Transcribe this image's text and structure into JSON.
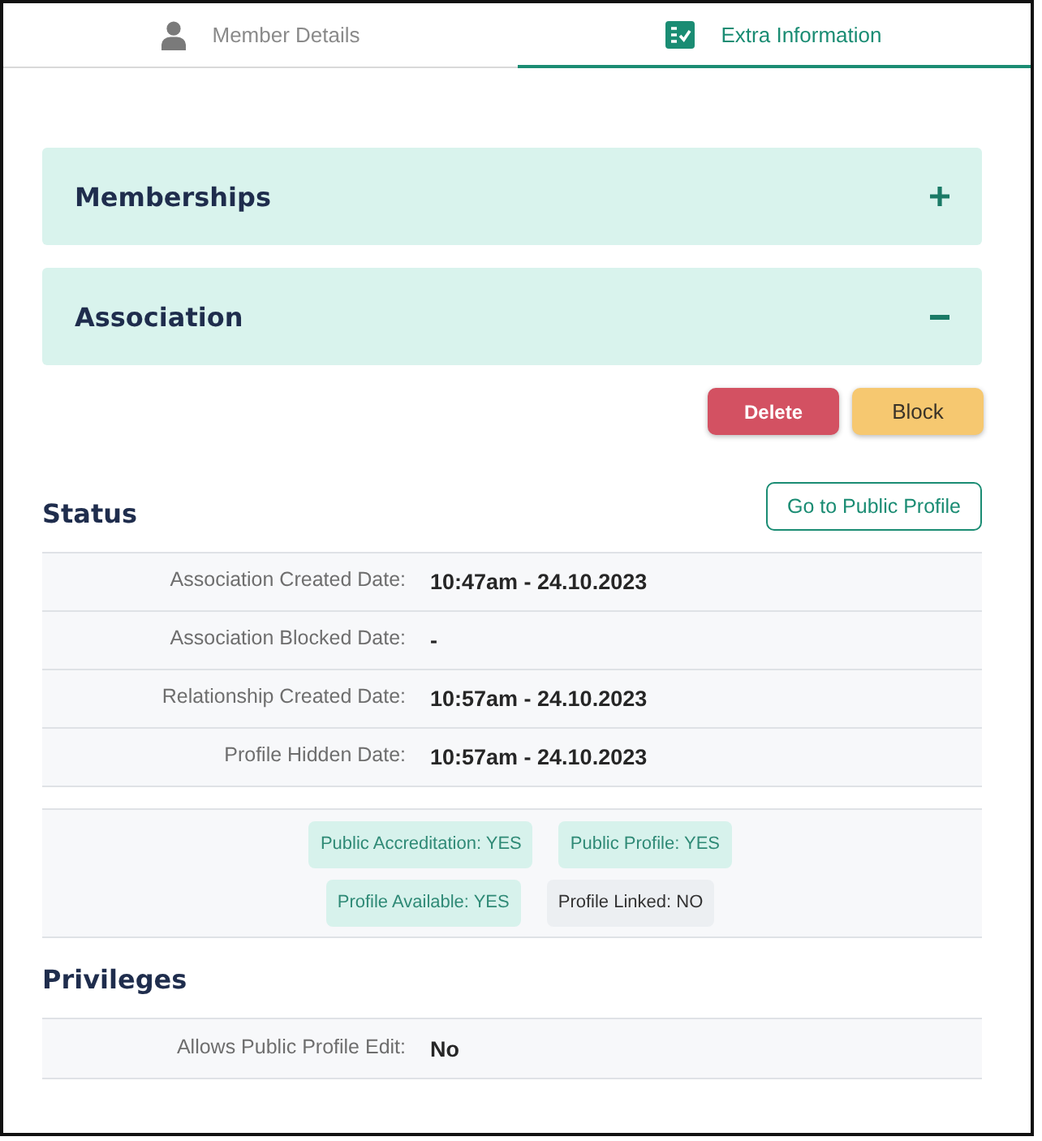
{
  "tabs": [
    {
      "label": "Member Details",
      "kind": "person",
      "selected": false
    },
    {
      "label": "Extra Information",
      "kind": "checklist",
      "selected": true
    }
  ],
  "accordions": [
    {
      "title": "Memberships",
      "expanded": false
    },
    {
      "title": "Association",
      "expanded": true
    }
  ],
  "actions": [
    {
      "label": "Delete",
      "kind": "danger"
    },
    {
      "label": "Block",
      "kind": "warning"
    }
  ],
  "status": {
    "heading": "Status",
    "link_button": "Go to Public Profile",
    "rows": [
      {
        "label": "Association Created Date:",
        "value": "10:47am - 24.10.2023"
      },
      {
        "label": "Association Blocked Date:",
        "value": "-"
      },
      {
        "label": "Relationship Created Date:",
        "value": "10:57am - 24.10.2023"
      },
      {
        "label": "Profile Hidden Date:",
        "value": "10:57am - 24.10.2023"
      }
    ],
    "badge_rows": [
      {
        "badges": [
          {
            "text": "Public Accreditation: YES",
            "active": true
          },
          {
            "text": "Public Profile: YES",
            "active": true
          }
        ]
      },
      {
        "badges": [
          {
            "text": "Profile Available: YES",
            "active": true
          },
          {
            "text": "Profile Linked: NO",
            "active": false
          }
        ]
      }
    ]
  },
  "privileges": {
    "heading": "Privileges",
    "rows": [
      {
        "label": "Allows Public Profile Edit:",
        "value": "No"
      }
    ]
  }
}
